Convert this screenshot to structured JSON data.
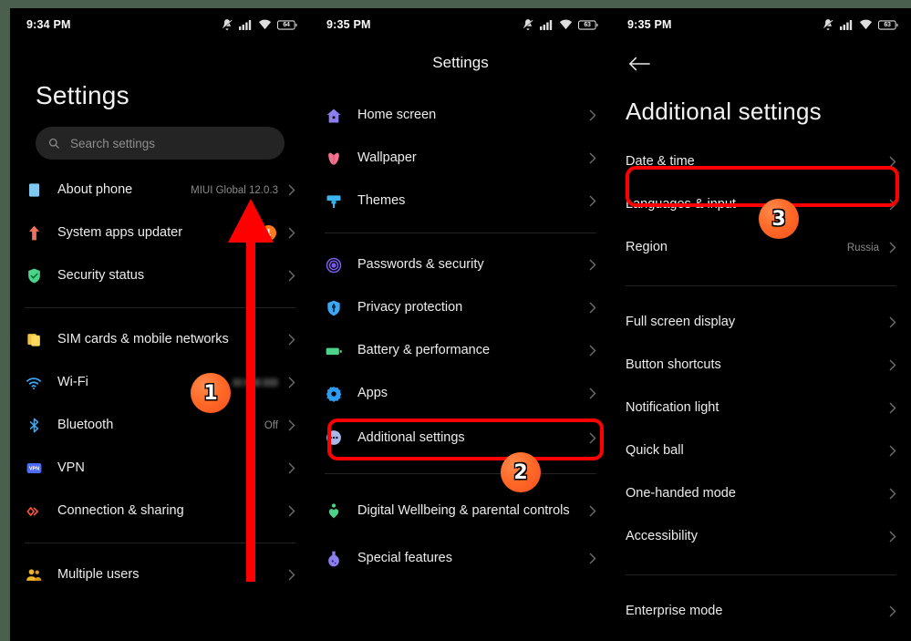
{
  "meta": {
    "accent_red": "#ff0000",
    "badge_orange": "#ff6a28",
    "background": "#000000",
    "frame_color": "#4a5f4d"
  },
  "panel1": {
    "statusbar": {
      "time": "9:34 PM",
      "icons": [
        "mute-icon",
        "signal-icon",
        "wifi-icon",
        "battery-icon"
      ],
      "battery_level": "64"
    },
    "title": "Settings",
    "search": {
      "placeholder": "Search settings"
    },
    "groups": [
      {
        "items": [
          {
            "icon": "about-phone-icon",
            "label": "About phone",
            "value": "MIUI Global 12.0.3",
            "badge": ""
          },
          {
            "icon": "system-updater-icon",
            "label": "System apps updater",
            "value": "",
            "badge": "1"
          },
          {
            "icon": "security-status-icon",
            "label": "Security status",
            "value": "",
            "badge": ""
          }
        ]
      },
      {
        "items": [
          {
            "icon": "sim-cards-icon",
            "label": "SIM cards & mobile networks",
            "value": "",
            "badge": ""
          },
          {
            "icon": "wifi-icon",
            "label": "Wi-Fi",
            "value": "",
            "badge": "",
            "blurred_value": true
          },
          {
            "icon": "bluetooth-icon",
            "label": "Bluetooth",
            "value": "Off",
            "badge": ""
          },
          {
            "icon": "vpn-icon",
            "label": "VPN",
            "value": "",
            "badge": ""
          },
          {
            "icon": "connection-sharing-icon",
            "label": "Connection & sharing",
            "value": "",
            "badge": ""
          }
        ]
      },
      {
        "items": [
          {
            "icon": "multiple-users-icon",
            "label": "Multiple users",
            "value": "",
            "badge": ""
          }
        ]
      }
    ]
  },
  "panel2": {
    "statusbar": {
      "time": "9:35 PM",
      "icons": [
        "mute-icon",
        "signal-icon",
        "wifi-icon",
        "battery-icon"
      ],
      "battery_level": "63"
    },
    "title": "Settings",
    "groups": [
      {
        "items": [
          {
            "icon": "home-screen-icon",
            "label": "Home screen"
          },
          {
            "icon": "wallpaper-icon",
            "label": "Wallpaper"
          },
          {
            "icon": "themes-icon",
            "label": "Themes"
          }
        ]
      },
      {
        "items": [
          {
            "icon": "passwords-security-icon",
            "label": "Passwords & security"
          },
          {
            "icon": "privacy-protection-icon",
            "label": "Privacy protection"
          },
          {
            "icon": "battery-performance-icon",
            "label": "Battery & performance"
          },
          {
            "icon": "apps-icon",
            "label": "Apps"
          },
          {
            "icon": "additional-settings-icon",
            "label": "Additional settings"
          }
        ]
      },
      {
        "items": [
          {
            "icon": "digital-wellbeing-icon",
            "label": "Digital Wellbeing & parental controls"
          },
          {
            "icon": "special-features-icon",
            "label": "Special features"
          }
        ]
      }
    ]
  },
  "panel3": {
    "statusbar": {
      "time": "9:35 PM",
      "icons": [
        "mute-icon",
        "signal-icon",
        "wifi-icon",
        "battery-icon"
      ],
      "battery_level": "63"
    },
    "back": "back-arrow-icon",
    "title": "Additional settings",
    "groups": [
      {
        "items": [
          {
            "label": "Date & time",
            "value": ""
          },
          {
            "label": "Languages & input",
            "value": ""
          },
          {
            "label": "Region",
            "value": "Russia"
          }
        ]
      },
      {
        "items": [
          {
            "label": "Full screen display",
            "value": ""
          },
          {
            "label": "Button shortcuts",
            "value": ""
          },
          {
            "label": "Notification light",
            "value": ""
          },
          {
            "label": "Quick ball",
            "value": ""
          },
          {
            "label": "One-handed mode",
            "value": ""
          },
          {
            "label": "Accessibility",
            "value": ""
          }
        ]
      },
      {
        "items": [
          {
            "label": "Enterprise mode",
            "value": ""
          }
        ]
      }
    ]
  },
  "annotations": {
    "badges": [
      {
        "text": "1",
        "target": "wifi-row-panel1"
      },
      {
        "text": "2",
        "target": "additional-settings-row"
      },
      {
        "text": "3",
        "target": "languages-input-row"
      }
    ],
    "arrow": {
      "name": "scroll-up-arrow",
      "color": "#ff0000"
    }
  }
}
